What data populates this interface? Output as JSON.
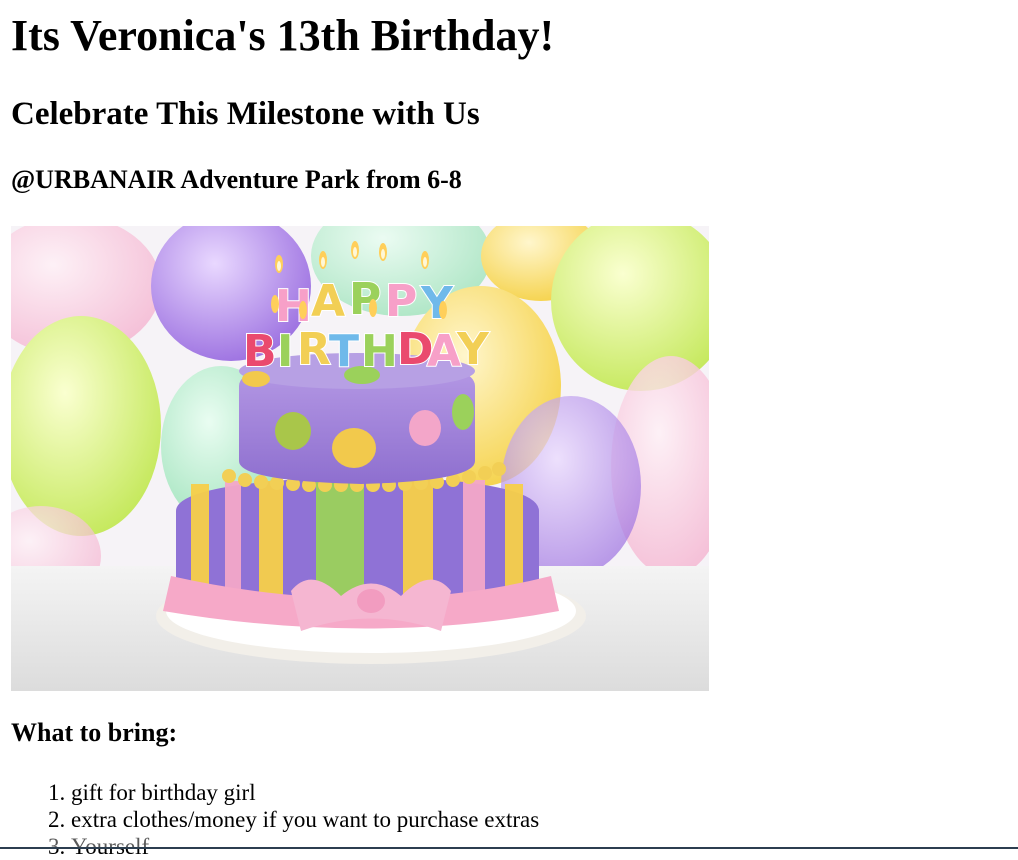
{
  "invitation": {
    "title": "Its Veronica's 13th Birthday!",
    "subtitle": "Celebrate This Milestone with Us",
    "location": "@URBANAIR Adventure Park from 6-8",
    "image": {
      "cake_text_line1": "HAPPY",
      "cake_text_line2": "BIRTHDAY"
    },
    "bring_heading": "What to bring:",
    "bring_items": [
      "gift for birthday girl",
      "extra clothes/money if you want to purchase extras",
      "Yourself"
    ]
  },
  "colors": {
    "cake_purple": "#a98bd9",
    "cake_yellow": "#f2c94c",
    "cake_green": "#9bd15b",
    "cake_pink": "#f3a6c9",
    "border_bottom": "#2c3e50"
  }
}
